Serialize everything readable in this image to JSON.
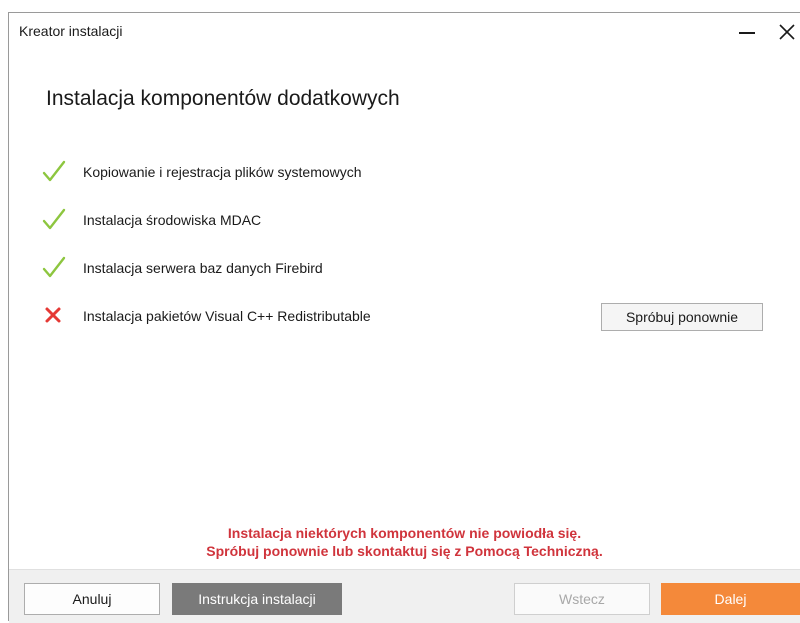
{
  "window": {
    "title": "Kreator instalacji"
  },
  "page": {
    "heading": "Instalacja komponentów dodatkowych"
  },
  "steps": [
    {
      "label": "Kopiowanie i rejestracja plików systemowych",
      "status": "success",
      "icon": "checkmark-icon"
    },
    {
      "label": "Instalacja środowiska MDAC",
      "status": "success",
      "icon": "checkmark-icon"
    },
    {
      "label": "Instalacja serwera baz danych Firebird",
      "status": "success",
      "icon": "checkmark-icon"
    },
    {
      "label": "Instalacja pakietów Visual C++ Redistributable",
      "status": "failed",
      "icon": "cross-icon"
    }
  ],
  "retry": {
    "label": "Spróbuj ponownie"
  },
  "error": {
    "line1": "Instalacja niektórych komponentów nie powiodła się.",
    "line2": "Spróbuj ponownie lub skontaktuj się z Pomocą Techniczną."
  },
  "footer": {
    "cancel_label": "Anuluj",
    "manual_label": "Instrukcja instalacji",
    "back_label": "Wstecz",
    "next_label": "Dalej"
  },
  "colors": {
    "success": "#8dc63f",
    "failure": "#e53935",
    "error_text": "#d0343c",
    "primary_button": "#f4893a",
    "secondary_button": "#7a7a7a"
  }
}
